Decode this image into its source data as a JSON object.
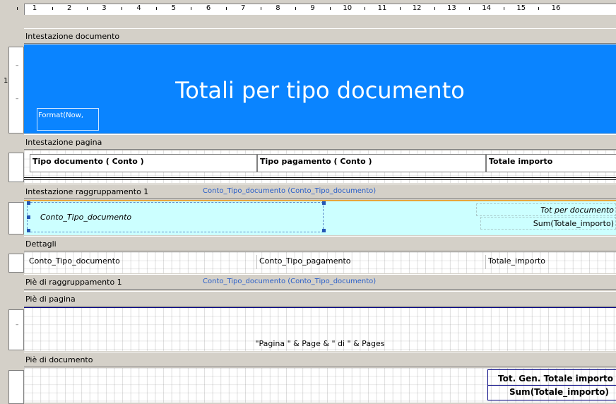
{
  "ruler": {
    "numbers": [
      "1",
      "2",
      "3",
      "4",
      "5",
      "6",
      "7",
      "8",
      "9",
      "10",
      "11",
      "12",
      "13",
      "14",
      "15",
      "16"
    ],
    "section_mark": "1"
  },
  "sections": {
    "report_header": "Intestazione documento",
    "page_header": "Intestazione pagina",
    "group_header": "Intestazione raggruppamento 1",
    "group_header_field": "Conto_Tipo_documento (Conto_Tipo_documento)",
    "detail": "Dettagli",
    "group_footer": "Piè di raggruppamento 1",
    "group_footer_field": "Conto_Tipo_documento (Conto_Tipo_documento)",
    "page_footer": "Piè di pagina",
    "report_footer": "Piè di documento"
  },
  "report_header": {
    "title": "Totali per tipo documento",
    "date_field": "Format(Now,",
    "bg_color": "#0a84ff"
  },
  "page_header": {
    "col1": "Tipo documento ( Conto )",
    "col2": "Tipo pagamento ( Conto )",
    "col3": "Totale importo"
  },
  "group_header": {
    "field": "Conto_Tipo_documento",
    "total_label": "Tot per documento",
    "total_expr": "Sum(Totale_importo)",
    "bg_color": "#ccffff"
  },
  "detail": {
    "col1": "Conto_Tipo_documento",
    "col2": "Conto_Tipo_pagamento",
    "col3": "Totale_importo"
  },
  "page_footer": {
    "expr": "\"Pagina \" & Page & \" di \" & Pages"
  },
  "report_footer": {
    "label": "Tot. Gen. Totale importo",
    "expr": "Sum(Totale_importo)"
  }
}
